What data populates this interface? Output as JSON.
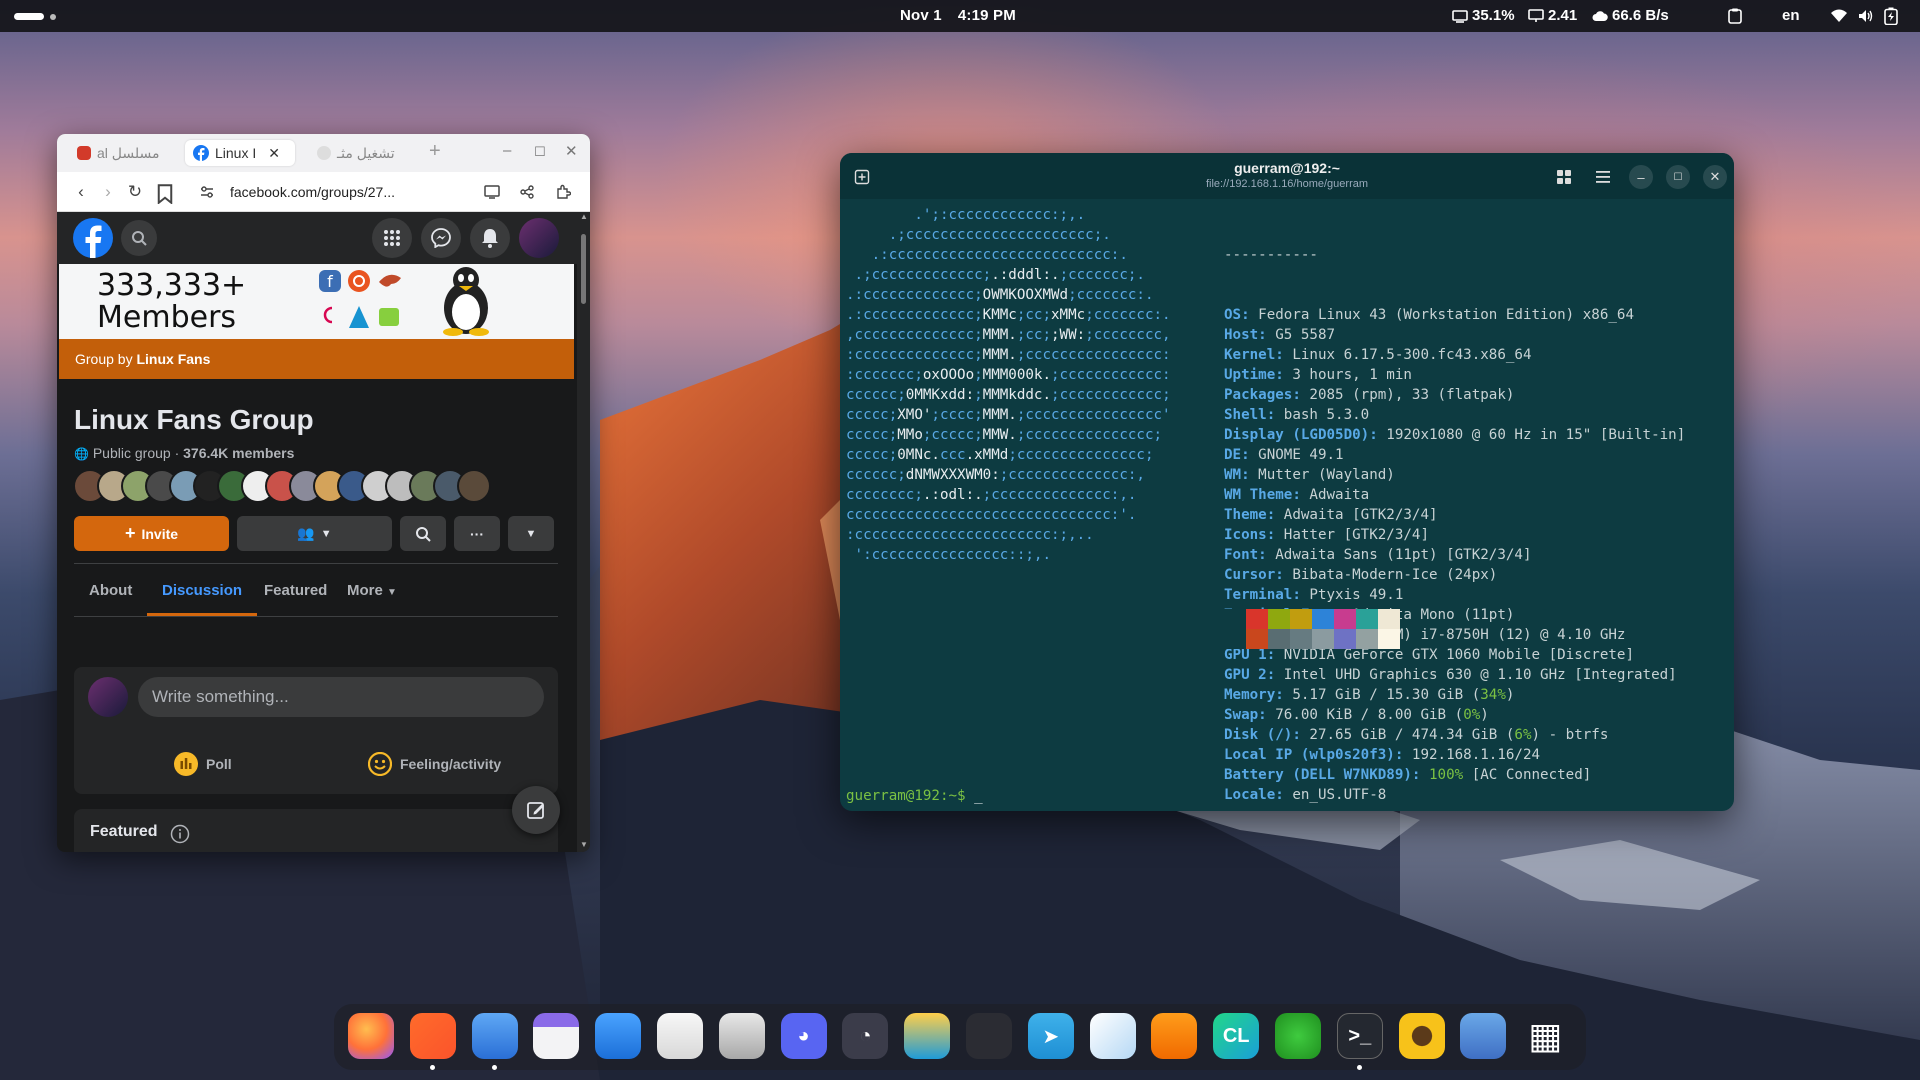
{
  "topbar": {
    "date": "Nov 1",
    "time": "4:19 PM",
    "cpu": "35.1%",
    "load": "2.41",
    "net": "66.6 B/s",
    "lang": "en"
  },
  "browser": {
    "tabs": [
      {
        "label": "مسلسل al",
        "active": false
      },
      {
        "label": "Linux I",
        "active": true
      },
      {
        "label": "تشغيل مثـ",
        "active": false
      }
    ],
    "url": "facebook.com/groups/27...",
    "banner_members": "333,333+",
    "banner_members_2": "Members",
    "group_by_prefix": "Group by",
    "group_by_name": "Linux Fans",
    "group_title": "Linux Fans Group",
    "group_privacy": "Public group",
    "group_members": "376.4K members",
    "invite_label": "Invite",
    "tabs_nav": [
      "About",
      "Discussion",
      "Featured",
      "More"
    ],
    "composer_placeholder": "Write something...",
    "poll_label": "Poll",
    "feeling_label": "Feeling/activity",
    "featured_heading": "Featured"
  },
  "terminal": {
    "title": "guerram@192:~",
    "subtitle": "file://192.168.1.16/home/guerram",
    "separator": "-----------",
    "info": [
      {
        "k": "OS",
        "v": "Fedora Linux 43 (Workstation Edition) x86_64"
      },
      {
        "k": "Host",
        "v": "G5 5587"
      },
      {
        "k": "Kernel",
        "v": "Linux 6.17.5-300.fc43.x86_64"
      },
      {
        "k": "Uptime",
        "v": "3 hours, 1 min"
      },
      {
        "k": "Packages",
        "v": "2085 (rpm), 33 (flatpak)"
      },
      {
        "k": "Shell",
        "v": "bash 5.3.0"
      },
      {
        "k": "Display (LGD05D0)",
        "v": "1920x1080 @ 60 Hz in 15\" [Built-in]"
      },
      {
        "k": "DE",
        "v": "GNOME 49.1"
      },
      {
        "k": "WM",
        "v": "Mutter (Wayland)"
      },
      {
        "k": "WM Theme",
        "v": "Adwaita"
      },
      {
        "k": "Theme",
        "v": "Adwaita [GTK2/3/4]"
      },
      {
        "k": "Icons",
        "v": "Hatter [GTK2/3/4]"
      },
      {
        "k": "Font",
        "v": "Adwaita Sans (11pt) [GTK2/3/4]"
      },
      {
        "k": "Cursor",
        "v": "Bibata-Modern-Ice (24px)"
      },
      {
        "k": "Terminal",
        "v": "Ptyxis 49.1"
      },
      {
        "k": "Terminal Font",
        "v": "Adwaita Mono (11pt)"
      },
      {
        "k": "CPU",
        "v": "Intel(R) Core(TM) i7-8750H (12) @ 4.10 GHz"
      },
      {
        "k": "GPU 1",
        "v": "NVIDIA GeForce GTX 1060 Mobile [Discrete]"
      },
      {
        "k": "GPU 2",
        "v": "Intel UHD Graphics 630 @ 1.10 GHz [Integrated]"
      },
      {
        "k": "Memory",
        "v": "5.17 GiB / 15.30 GiB (",
        "g": "34%",
        "t": ")"
      },
      {
        "k": "Swap",
        "v": "76.00 KiB / 8.00 GiB (",
        "g": "0%",
        "t": ")"
      },
      {
        "k": "Disk (/)",
        "v": "27.65 GiB / 474.34 GiB (",
        "g": "6%",
        "t": ") - btrfs"
      },
      {
        "k": "Local IP (wlp0s20f3)",
        "v": "192.168.1.16/24"
      },
      {
        "k": "Battery (DELL W7NKD89)",
        "v": "",
        "g": "100%",
        "t": " [AC Connected]"
      },
      {
        "k": "Locale",
        "v": "en_US.UTF-8"
      }
    ],
    "prompt": "guerram@192:~$",
    "palette_top": [
      "#0d3b41",
      "#d9352b",
      "#8fa80f",
      "#c19d0f",
      "#2d83d8",
      "#c83c8f",
      "#2aa198",
      "#efe8d5"
    ],
    "palette_bottom": [
      "#0d3b41",
      "#c9471d",
      "#596d72",
      "#667b81",
      "#8b9ba0",
      "#6e72c4",
      "#93a1a1",
      "#fbf6e6"
    ]
  },
  "dock": {
    "apps": [
      "firefox-icon",
      "brave-icon",
      "files-icon",
      "calendar-icon",
      "software-icon",
      "text-editor-icon",
      "calculator-icon",
      "discord-icon",
      "clocks-icon",
      "files-alt-icon",
      "obs-icon",
      "telegram-icon",
      "network-icon",
      "vlc-icon",
      "clion-icon",
      "qbittorrent-icon",
      "terminal-icon",
      "sunflower-icon",
      "settings-icon",
      "app-grid-icon"
    ]
  }
}
